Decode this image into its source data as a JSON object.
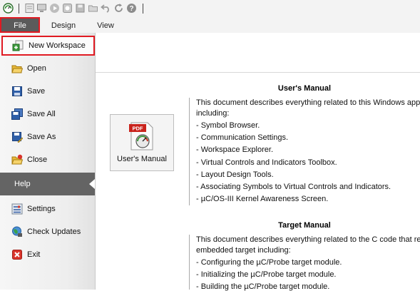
{
  "ribbon": {
    "tabs": [
      {
        "label": "File"
      },
      {
        "label": "Design"
      },
      {
        "label": "View"
      }
    ]
  },
  "quick_access": {
    "icons": [
      "app-logo-icon",
      "new-icon",
      "monitor-icon",
      "play-icon",
      "stop-icon",
      "save-icon",
      "open-folder-icon",
      "undo-icon",
      "refresh-icon",
      "help-icon"
    ]
  },
  "file_menu": {
    "items": [
      {
        "label": "New Workspace",
        "icon": "new-workspace-icon"
      },
      {
        "label": "Open",
        "icon": "open-folder-icon"
      },
      {
        "label": "Save",
        "icon": "save-icon"
      },
      {
        "label": "Save All",
        "icon": "save-all-icon"
      },
      {
        "label": "Save As",
        "icon": "save-as-icon"
      },
      {
        "label": "Close",
        "icon": "close-folder-icon"
      },
      {
        "label": "Help",
        "icon": ""
      },
      {
        "label": "Settings",
        "icon": "settings-icon"
      },
      {
        "label": "Check Updates",
        "icon": "globe-icon"
      },
      {
        "label": "Exit",
        "icon": "exit-icon"
      }
    ]
  },
  "help_page": {
    "doc_button": {
      "label": "User's Manual",
      "badge": "PDF"
    },
    "user_manual": {
      "title": "User's Manual",
      "intro_line1": "This document describes everything related to this Windows applica",
      "intro_line2": "including:",
      "bullets": [
        "- Symbol Browser.",
        "- Communication Settings.",
        "- Workspace Explorer.",
        "- Virtual Controls and Indicators Toolbox.",
        "- Layout Design Tools.",
        "- Associating Symbols to Virtual Controls and Indicators.",
        "- µC/OS-III Kernel Awareness Screen."
      ]
    },
    "target_manual": {
      "title": "Target Manual",
      "intro_line1": "This document describes everything related to the C code that resid",
      "intro_line2": "embedded target including:",
      "bullets": [
        "- Configuring the µC/Probe target module.",
        "- Initializing the µC/Probe target module.",
        "- Building the µC/Probe target module."
      ]
    }
  },
  "colors": {
    "highlight_border": "#e01a22",
    "selected_tab_bg": "#5b5b5b",
    "help_item_bg": "#646464"
  }
}
